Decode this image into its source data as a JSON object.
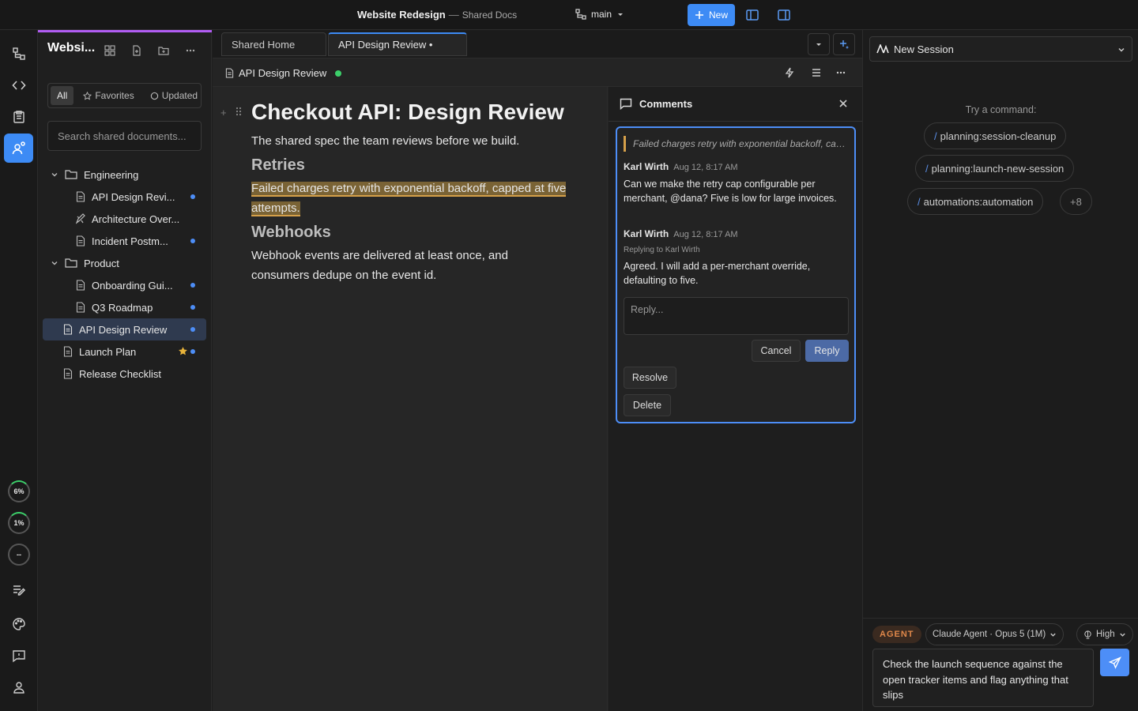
{
  "titlebar": {
    "title": "Website Redesign",
    "separator": "—",
    "subtitle": "Shared Docs",
    "branch": "main",
    "new_label": "New"
  },
  "rail": {
    "stats": [
      "6%",
      "1%",
      "--"
    ]
  },
  "sidebar": {
    "title": "Websi...",
    "filters": [
      "All",
      "Favorites",
      "Updated"
    ],
    "search_placeholder": "Search shared documents...",
    "tree": [
      {
        "label": "Engineering",
        "type": "folder"
      },
      {
        "label": "API Design Revi...",
        "type": "doc",
        "dot": true
      },
      {
        "label": "Architecture Over...",
        "type": "drawing",
        "dot": false
      },
      {
        "label": "Incident Postm...",
        "type": "doc",
        "dot": true
      },
      {
        "label": "Product",
        "type": "folder"
      },
      {
        "label": "Onboarding Gui...",
        "type": "doc",
        "dot": true
      },
      {
        "label": "Q3 Roadmap",
        "type": "doc",
        "dot": true
      },
      {
        "label": "API Design Review",
        "type": "doc",
        "dot": true,
        "selected": true
      },
      {
        "label": "Launch Plan",
        "type": "doc",
        "dot": true,
        "star": true
      },
      {
        "label": "Release Checklist",
        "type": "doc",
        "dot": false
      }
    ]
  },
  "tabs": [
    {
      "label": "Shared Home"
    },
    {
      "label": "API Design Review •",
      "active": true
    }
  ],
  "docbar": {
    "name": "API Design Review"
  },
  "document": {
    "title": "Checkout API: Design Review",
    "intro": "The shared spec the team reviews before we build.",
    "h_retries": "Retries",
    "retries_text": "Failed charges retry with exponential backoff, capped at five attempts.",
    "h_webhooks": "Webhooks",
    "webhooks_text": "Webhook events are delivered at least once, and consumers dedupe on the event id."
  },
  "comments": {
    "header": "Comments",
    "quote": "Failed charges retry with exponential backoff, capped at five attempts.",
    "thread": [
      {
        "author": "Karl Wirth",
        "time": "Aug 12, 8:17 AM",
        "text": "Can we make the retry cap configurable per merchant, @dana? Five is low for large invoices."
      },
      {
        "author": "Karl Wirth",
        "time": "Aug 12, 8:17 AM",
        "replying_to": "Replying to Karl Wirth",
        "text": "Agreed. I will add a per-merchant override, defaulting to five."
      }
    ],
    "reply_placeholder": "Reply...",
    "cancel": "Cancel",
    "reply": "Reply",
    "resolve": "Resolve",
    "delete": "Delete"
  },
  "assistant": {
    "session": "New Session",
    "try_label": "Try a command:",
    "commands": [
      "planning:session-cleanup",
      "planning:launch-new-session",
      "automations:automation"
    ],
    "more": "+8",
    "agent_badge": "AGENT",
    "model": "Claude Agent · Opus 5 (1M)",
    "effort": "High",
    "prompt": "Check the launch sequence against the open tracker items and flag anything that slips"
  },
  "colors": {
    "accent": "#3d8bf5",
    "highlight": "#d5a04a",
    "sidebar_stripe": "#b15cf3",
    "saved_dot": "#3ccf6a"
  }
}
